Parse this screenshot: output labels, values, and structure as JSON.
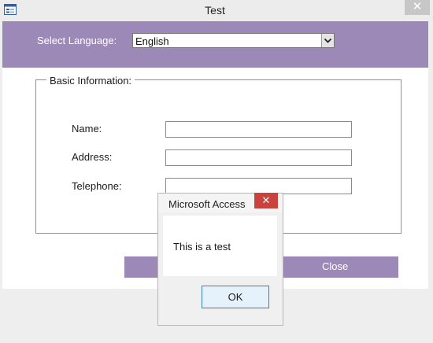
{
  "window": {
    "title": "Test",
    "close_glyph": "✕",
    "icon": "form-window-icon"
  },
  "form": {
    "language_label": "Select Language:",
    "language_value": "English",
    "group_title": "Basic Information:",
    "fields": [
      {
        "label": "Name:",
        "value": ""
      },
      {
        "label": "Address:",
        "value": ""
      },
      {
        "label": "Telephone:",
        "value": ""
      }
    ],
    "close_button": "Close"
  },
  "dialog": {
    "title": "Microsoft Access",
    "close_glyph": "✕",
    "message": "This is a test",
    "ok_button": "OK"
  },
  "colors": {
    "accent": "#9d89b8",
    "dialog_close": "#c9433e",
    "ok_border": "#3c7fb1"
  }
}
